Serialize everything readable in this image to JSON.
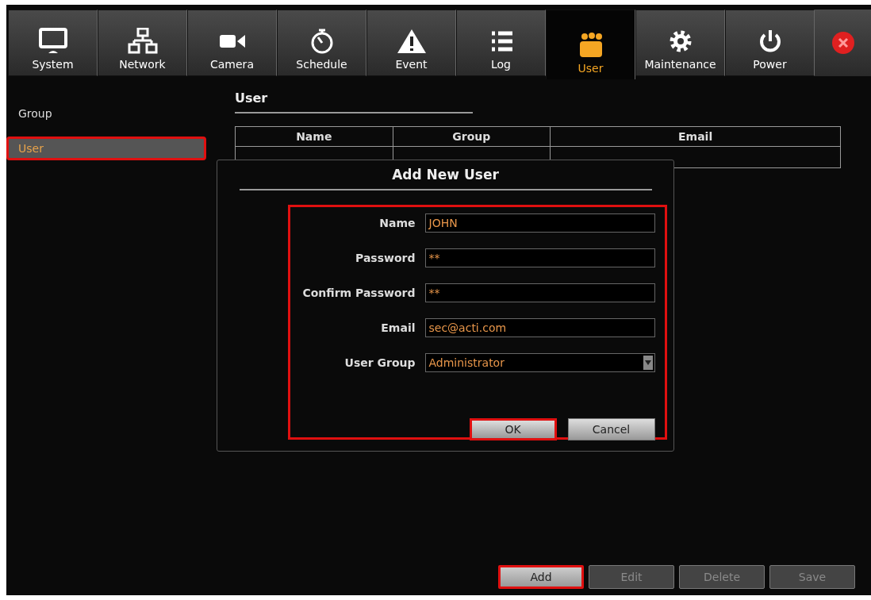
{
  "tabs": [
    {
      "kind": "monitor",
      "label": "System",
      "selected": false
    },
    {
      "kind": "network",
      "label": "Network",
      "selected": false
    },
    {
      "kind": "camera",
      "label": "Camera",
      "selected": false
    },
    {
      "kind": "stopwatch",
      "label": "Schedule",
      "selected": false
    },
    {
      "kind": "warning",
      "label": "Event",
      "selected": false
    },
    {
      "kind": "list",
      "label": "Log",
      "selected": false
    },
    {
      "kind": "users",
      "label": "User",
      "selected": true
    },
    {
      "kind": "gear",
      "label": "Maintenance",
      "selected": false
    },
    {
      "kind": "power",
      "label": "Power",
      "selected": false
    }
  ],
  "sidebar": {
    "items": [
      {
        "label": "Group",
        "selected": false,
        "highlighted": false
      },
      {
        "label": "User",
        "selected": true,
        "highlighted": true
      }
    ]
  },
  "section_title": "User",
  "table": {
    "columns": [
      "Name",
      "Group",
      "Email"
    ]
  },
  "dialog": {
    "title": "Add New User",
    "highlighted": true,
    "fields": [
      {
        "kind": "text",
        "label": "Name",
        "value": "JOHN"
      },
      {
        "kind": "text",
        "label": "Password",
        "value": "**"
      },
      {
        "kind": "text",
        "label": "Confirm Password",
        "value": "**"
      },
      {
        "kind": "text",
        "label": "Email",
        "value": "sec@acti.com"
      },
      {
        "kind": "select",
        "label": "User Group",
        "value": "Administrator"
      }
    ],
    "buttons": [
      {
        "label": "OK",
        "highlighted": true
      },
      {
        "label": "Cancel",
        "highlighted": false
      }
    ]
  },
  "buttons": [
    {
      "label": "Add",
      "disabled": false,
      "highlighted": true
    },
    {
      "label": "Edit",
      "disabled": true,
      "highlighted": false
    },
    {
      "label": "Delete",
      "disabled": true,
      "highlighted": false
    },
    {
      "label": "Save",
      "disabled": true,
      "highlighted": false
    }
  ]
}
